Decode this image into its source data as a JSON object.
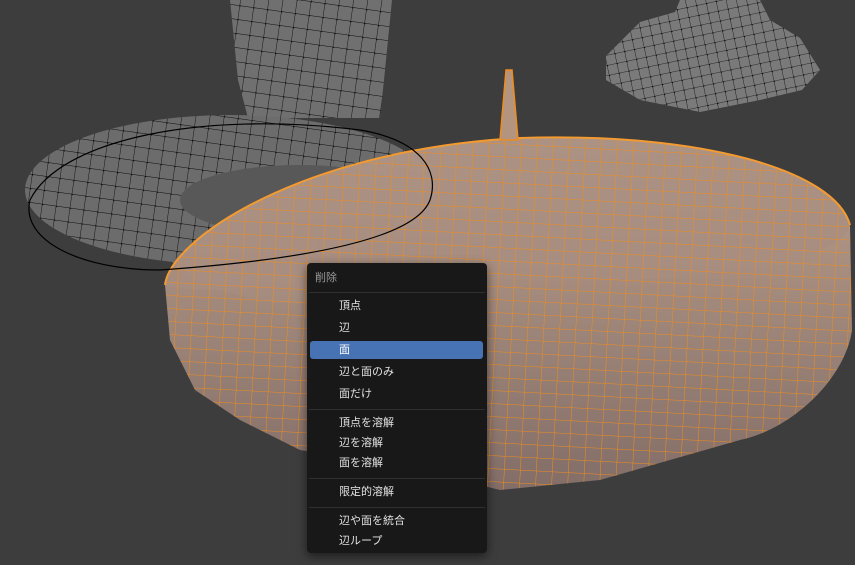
{
  "context_menu": {
    "title": "削除",
    "items": [
      {
        "label": "頂点"
      },
      {
        "label": "辺"
      },
      {
        "label": "面",
        "active": true
      },
      {
        "label": "辺と面のみ"
      },
      {
        "label": "面だけ"
      },
      {
        "label": "頂点を溶解"
      },
      {
        "label": "辺を溶解"
      },
      {
        "label": "面を溶解"
      },
      {
        "label": "限定的溶解"
      },
      {
        "label": "辺や面を統合"
      },
      {
        "label": "辺ループ"
      }
    ]
  },
  "colors": {
    "viewport_background": "#3d3d3d",
    "mesh_gray": "#6e6e6e",
    "selection_orange": "#f08c1e",
    "menu_background": "#181818",
    "menu_highlight": "#4772b3"
  }
}
